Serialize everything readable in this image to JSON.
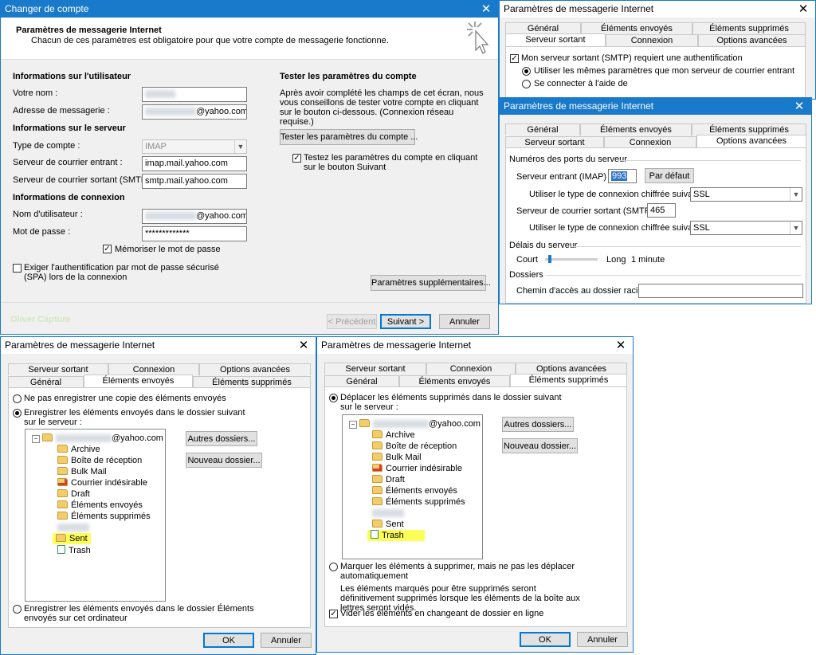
{
  "wiz": {
    "title": "Changer de compte",
    "header_title": "Paramètres de messagerie Internet",
    "header_sub": "Chacun de ces paramètres est obligatoire pour que votre compte de messagerie fonctionne.",
    "sec_user": "Informations sur l'utilisateur",
    "lbl_name": "Votre nom :",
    "lbl_email": "Adresse de messagerie :",
    "email_domain": "@yahoo.com",
    "sec_server": "Informations sur le serveur",
    "lbl_type": "Type de compte :",
    "type_value": "IMAP",
    "lbl_incoming": "Serveur de courrier entrant :",
    "incoming_value": "imap.mail.yahoo.com",
    "lbl_outgoing": "Serveur de courrier sortant (SMTP) :",
    "outgoing_value": "smtp.mail.yahoo.com",
    "sec_login": "Informations de connexion",
    "lbl_user": "Nom d'utilisateur :",
    "user_domain": "@yahoo.com",
    "lbl_pass": "Mot de passe :",
    "pass_value": "*************",
    "remember": "Mémoriser le mot de passe",
    "spa": "Exiger l'authentification par mot de passe sécurisé (SPA) lors de la connexion",
    "test_title": "Tester les paramètres du compte",
    "test_desc": "Après avoir complété les champs de cet écran, nous vous conseillons de tester votre compte en cliquant sur le bouton ci-dessous. (Connexion réseau requise.)",
    "test_button": "Tester les paramètres du compte ...",
    "test_next": "Testez les paramètres du compte en cliquant sur le bouton Suivant",
    "more_button": "Paramètres supplémentaires...",
    "watermark": "Oliver Capture",
    "prev": "< Précédent",
    "next": "Suivant >",
    "cancel": "Annuler"
  },
  "tabs": {
    "general": "Général",
    "sent": "Éléments envoyés",
    "deleted": "Éléments supprimés",
    "outgoing": "Serveur sortant",
    "connection": "Connexion",
    "advanced": "Options avancées"
  },
  "d1": {
    "title": "Paramètres de messagerie Internet",
    "smtp_auth": "Mon serveur sortant (SMTP) requiert une authentification",
    "same_settings": "Utiliser les mêmes paramètres que mon serveur de courrier entrant",
    "login_with": "Se connecter à l'aide de"
  },
  "d2": {
    "title": "Paramètres de messagerie Internet",
    "ports_title": "Numéros des ports du serveur",
    "in_label": "Serveur entrant (IMAP) :",
    "in_port": "993",
    "default_btn": "Par défaut",
    "enc_label": "Utiliser le type de connexion chiffrée suivant :",
    "enc_value": "SSL",
    "out_label": "Serveur de courrier sortant (SMTP) :",
    "out_port": "465",
    "enc2_value": "SSL",
    "timeout_title": "Délais du serveur",
    "short": "Court",
    "long": "Long",
    "timeout_value": "1 minute",
    "folders_title": "Dossiers",
    "root_label": "Chemin d'accès au dossier racine :"
  },
  "d3": {
    "title": "Paramètres de messagerie Internet",
    "opt_none": "Ne pas enregistrer une copie des éléments envoyés",
    "opt_server": "Enregistrer les éléments envoyés dans le dossier suivant sur le serveur :",
    "account": "@yahoo.com",
    "folders": [
      "Archive",
      "Boîte de réception",
      "Bulk Mail",
      "Courrier indésirable",
      "Draft",
      "Éléments envoyés",
      "Éléments supprimés"
    ],
    "sent": "Sent",
    "trash": "Trash",
    "other_btn": "Autres dossiers...",
    "new_btn": "Nouveau dossier...",
    "opt_local": "Enregistrer les éléments envoyés dans le dossier Éléments envoyés sur cet ordinateur",
    "ok": "OK",
    "cancel": "Annuler"
  },
  "d4": {
    "title": "Paramètres de messagerie Internet",
    "opt_move": "Déplacer les éléments supprimés dans le dossier suivant sur le serveur :",
    "account": "@yahoo.com",
    "folders": [
      "Archive",
      "Boîte de réception",
      "Bulk Mail",
      "Courrier indésirable",
      "Draft",
      "Éléments envoyés",
      "Éléments supprimés"
    ],
    "sent": "Sent",
    "trash": "Trash",
    "other_btn": "Autres dossiers...",
    "new_btn": "Nouveau dossier...",
    "opt_mark": "Marquer les éléments à supprimer, mais ne pas les déplacer automatiquement",
    "mark_desc": "Les éléments marqués pour être supprimés seront définitivement supprimés lorsque les éléments de la boîte aux lettres seront vidés.",
    "purge": "Vider les éléments en changeant de dossier en ligne",
    "ok": "OK",
    "cancel": "Annuler"
  }
}
